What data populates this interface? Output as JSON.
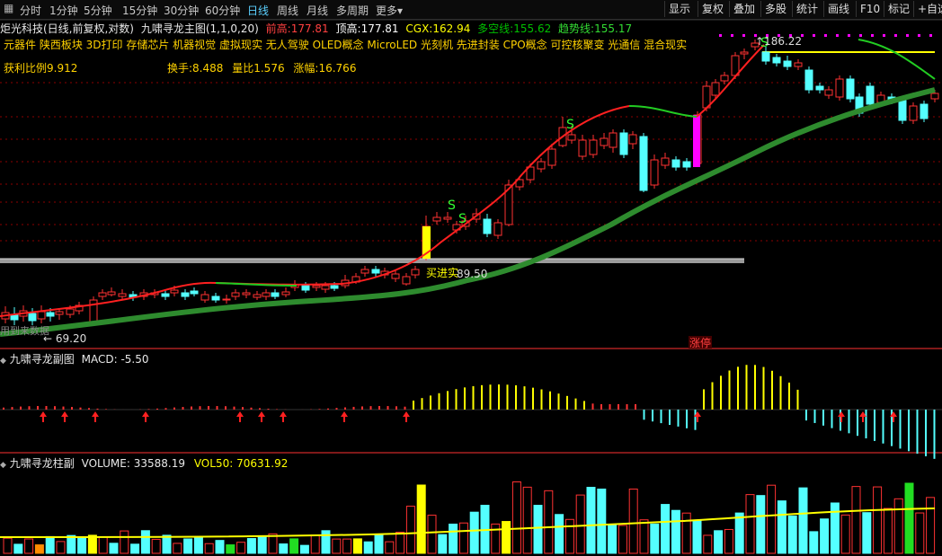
{
  "toolbar": {
    "timeframes": [
      "分时",
      "1分钟",
      "5分钟",
      "15分钟",
      "30分钟",
      "60分钟",
      "日线",
      "周线",
      "月线",
      "多周期",
      "更多"
    ],
    "active": "日线",
    "more_arrow": "▾",
    "buttons": [
      "显示",
      "复权",
      "叠加",
      "多股",
      "统计",
      "画线",
      "F10",
      "标记",
      "+自选"
    ]
  },
  "main": {
    "stock": "炬光科技(日线,前复权,对数)",
    "indicator": "九啸寻龙主图(1,1,0,20)",
    "prev_high_label": "前高:",
    "prev_high": "177.81",
    "top_high_label": "顶高:",
    "top_high": "177.81",
    "cgx_label": "CGX:",
    "cgx": "162.94",
    "duokong_label": "多空线:",
    "duokong": "155.62",
    "trend_label": "趋势线:",
    "trend": "155.17",
    "concepts": "元器件  陕西板块  3D打印  存储芯片  机器视觉  虚拟现实  无人驾驶  OLED概念  MicroLED  光刻机  先进封装  CPO概念  可控核聚变  光通信  混合现实",
    "profit_ratio": "获利比例9.912",
    "turnover": "换手:8.488",
    "volume_ratio": "量比1.576",
    "amplitude": "涨幅:16.766",
    "high_marker": "186.22",
    "low_marker": "69.20",
    "buy_text": "买进实",
    "break_price": "89.50",
    "left_note": "用到来数据",
    "limit_up_tag": "涨停",
    "signal": "S"
  },
  "macd_pane": {
    "name": "九啸寻龙副图",
    "label": "MACD:",
    "value": "-5.50"
  },
  "volume_pane": {
    "name": "九啸寻龙柱副",
    "label": "VOLUME:",
    "value": "33588.19",
    "vol50_label": "VOL50:",
    "vol50": "70631.92"
  },
  "colors": {
    "up": "#ff3232",
    "down": "#54ffff",
    "yellow": "#ffff00",
    "trend_green": "#2e8b2e",
    "magenta": "#ff00ff"
  }
}
